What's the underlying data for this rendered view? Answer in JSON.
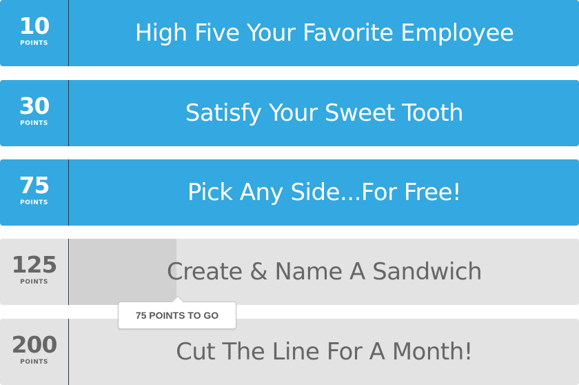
{
  "colors": {
    "unlocked_bg": "#34a8e0",
    "locked_bg": "#e3e3e3",
    "progress_fill": "#d1d1d1",
    "unlocked_text": "#ffffff",
    "locked_text": "#666666"
  },
  "rewards": [
    {
      "points": "10",
      "unit": "POINTS",
      "title": "High Five Your Favorite Employee",
      "status": "unlocked"
    },
    {
      "points": "30",
      "unit": "POINTS",
      "title": "Satisfy Your Sweet Tooth",
      "status": "unlocked"
    },
    {
      "points": "75",
      "unit": "POINTS",
      "title": "Pick Any Side...For Free!",
      "status": "unlocked"
    },
    {
      "points": "125",
      "unit": "POINTS",
      "title": "Create & Name A Sandwich",
      "status": "locked",
      "progress_fraction": 0.21
    },
    {
      "points": "200",
      "unit": "POINTS",
      "title": "Cut The Line For A Month!",
      "status": "locked"
    }
  ],
  "tooltip": {
    "text": "75 POINTS TO GO"
  }
}
